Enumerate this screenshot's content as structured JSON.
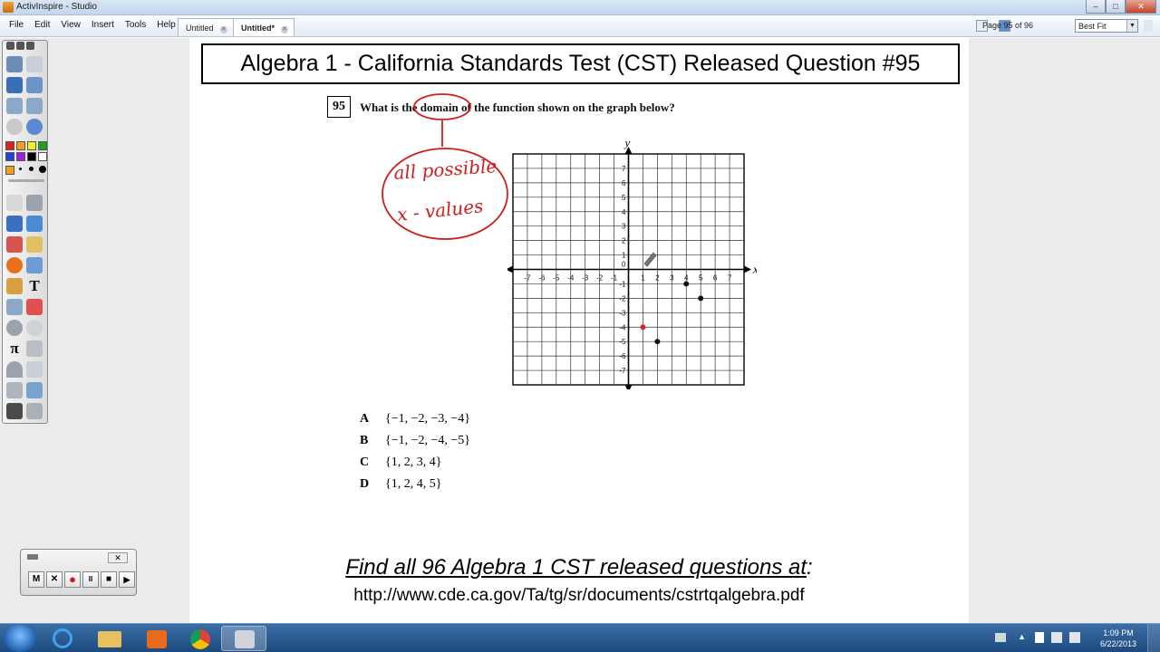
{
  "window": {
    "title": "ActivInspire - Studio"
  },
  "menu": {
    "items": [
      "File",
      "Edit",
      "View",
      "Insert",
      "Tools",
      "Help"
    ]
  },
  "tabs": [
    {
      "label": "Untitled",
      "active": false
    },
    {
      "label": "Untitled*",
      "active": true
    }
  ],
  "page_info": "Page 95 of 96",
  "zoom": "Best Fit",
  "question": {
    "title": "Algebra 1 - California Standards Test (CST) Released Question #95",
    "number": "95",
    "text": "What is the domain of the function shown on the graph below?",
    "annotation": [
      "all possible",
      "x - values"
    ],
    "choices": [
      {
        "letter": "A",
        "text": "{−1, −2, −3, −4}"
      },
      {
        "letter": "B",
        "text": "{−1, −2, −4, −5}"
      },
      {
        "letter": "C",
        "text": "{1, 2, 3, 4}"
      },
      {
        "letter": "D",
        "text": "{1, 2, 4, 5}"
      }
    ]
  },
  "chart_data": {
    "type": "scatter",
    "xlabel": "x",
    "ylabel": "y",
    "xlim": [
      -8,
      8
    ],
    "ylim": [
      -8,
      8
    ],
    "grid": true,
    "x_ticks": [
      -7,
      -6,
      -5,
      -4,
      -3,
      -2,
      -1,
      1,
      2,
      3,
      4,
      5,
      6,
      7
    ],
    "y_ticks": [
      7,
      6,
      5,
      4,
      3,
      2,
      1,
      -1,
      -2,
      -3,
      -4,
      -5,
      -6,
      -7
    ],
    "origin_label": "0",
    "points": [
      {
        "x": 1,
        "y": -4,
        "color": "#cc2a2a"
      },
      {
        "x": 2,
        "y": -5,
        "color": "#111111"
      },
      {
        "x": 4,
        "y": -1,
        "color": "#111111"
      },
      {
        "x": 5,
        "y": -2,
        "color": "#111111"
      }
    ]
  },
  "footer": {
    "line1": "Find all 96 Algebra 1 CST released questions at",
    "line1_suffix": ":",
    "url": "http://www.cde.ca.gov/Ta/tg/sr/documents/cstrtqalgebra.pdf"
  },
  "recorder": {
    "buttons": [
      "M",
      "✕",
      "●",
      "II",
      "■",
      "▶"
    ]
  },
  "taskbar": {
    "time": "1:09 PM",
    "date": "6/22/2013"
  },
  "colors": {
    "annotation_red": "#cc1f1f",
    "palette": [
      "#e02020",
      "#f0a020",
      "#f0f020",
      "#20a020",
      "#2040e0",
      "#a020e0",
      "#e020c0",
      "#000000",
      "#ffffff",
      "#404040"
    ]
  }
}
